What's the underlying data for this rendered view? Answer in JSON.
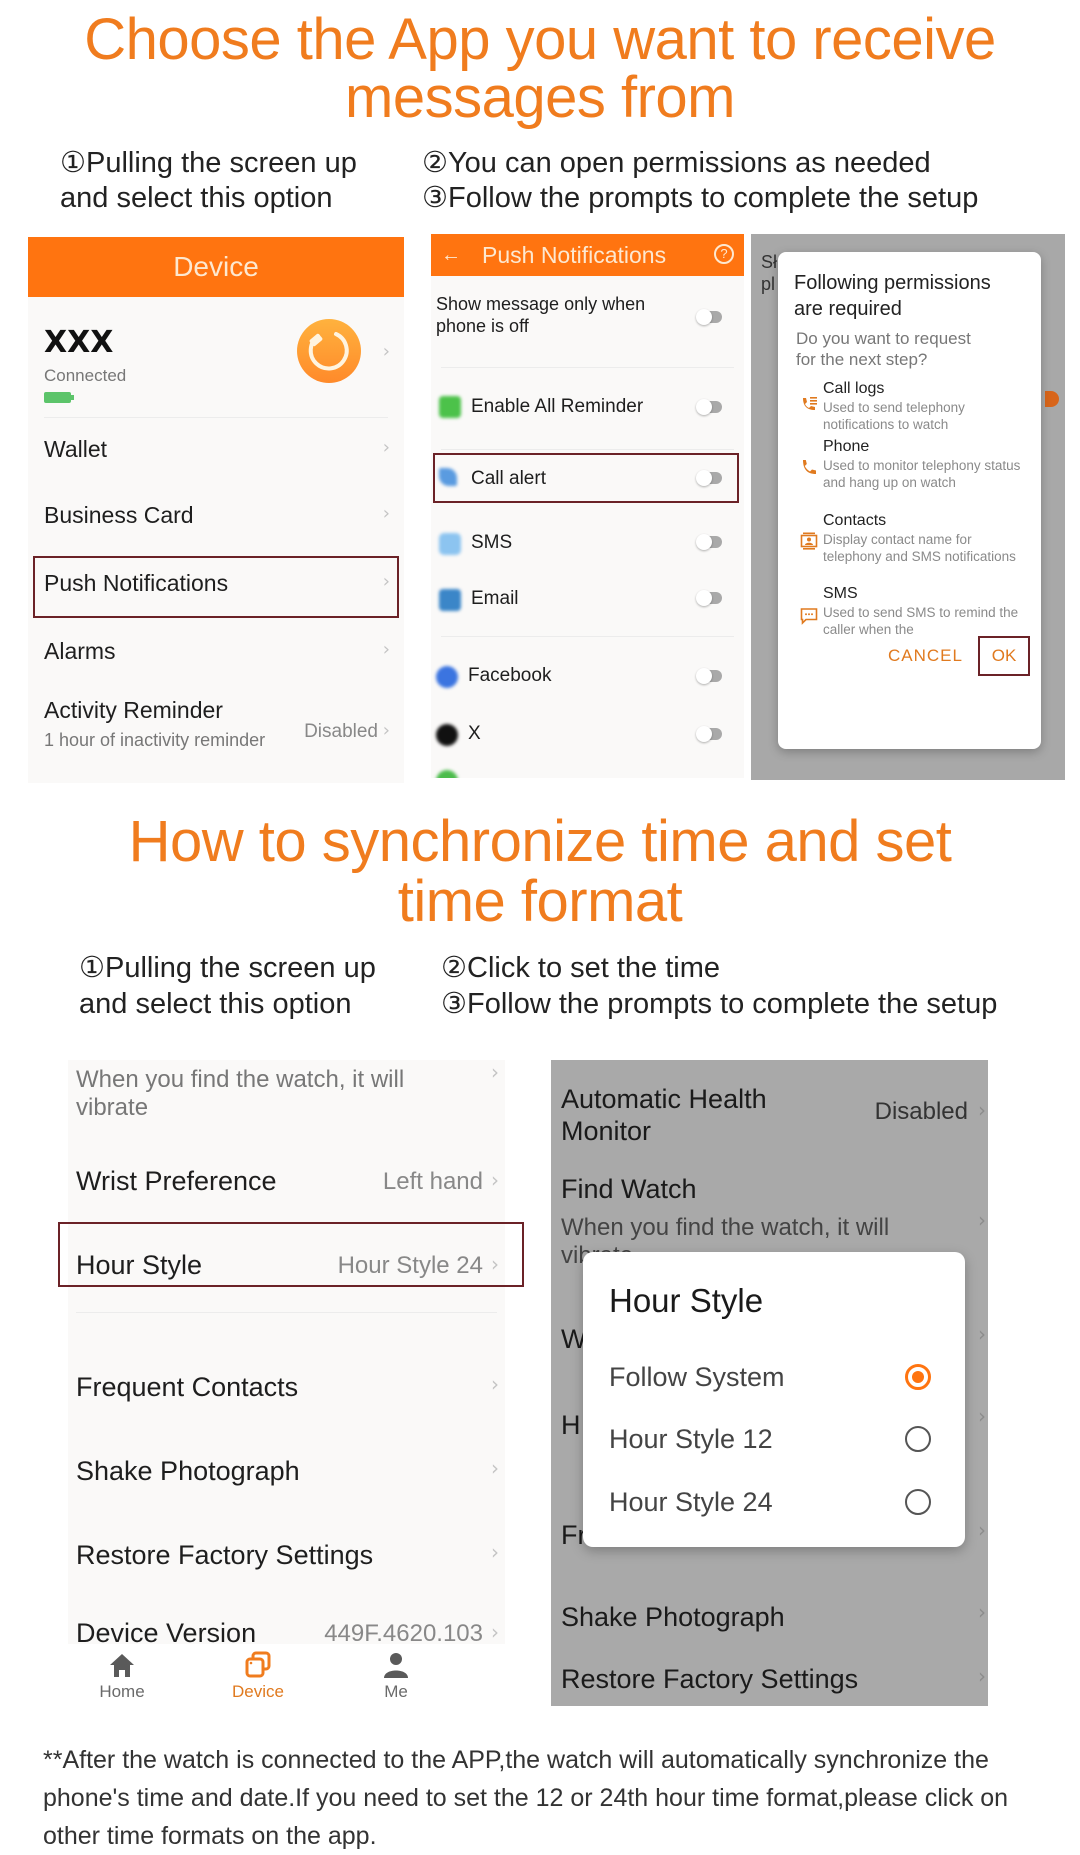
{
  "section1": {
    "title_line1": "Choose the App you want to receive",
    "title_line2": "messages from",
    "steps": [
      {
        "num": "①",
        "line1": "Pulling the screen up",
        "line2": "and select this option"
      },
      {
        "num": "②",
        "line1": "You can open permissions as needed"
      },
      {
        "num": "③",
        "line1": "Follow the prompts to complete the setup"
      }
    ]
  },
  "device_screen": {
    "title": "Device",
    "device_name": "XXX",
    "status": "Connected",
    "battery_color": "#5cc46a",
    "items": [
      {
        "label": "Wallet"
      },
      {
        "label": "Business Card"
      },
      {
        "label": "Push Notifications",
        "highlighted": true
      },
      {
        "label": "Alarms"
      },
      {
        "label": "Activity Reminder",
        "sub": "1 hour of inactivity reminder",
        "value": "Disabled"
      }
    ]
  },
  "push_screen": {
    "title": "Push Notifications",
    "items": [
      {
        "label": "Show message only when",
        "label2": "phone is off",
        "on": false
      },
      {
        "label": "Enable All Reminder",
        "icon": "reminder-icon",
        "on": false
      },
      {
        "label": "Call alert",
        "icon": "phone-icon",
        "on": false,
        "highlighted": true
      },
      {
        "label": "SMS",
        "icon": "sms-icon",
        "on": false
      },
      {
        "label": "Email",
        "icon": "email-icon",
        "on": false
      },
      {
        "label": "Facebook",
        "icon": "facebook-icon",
        "on": false
      },
      {
        "label": "X",
        "icon": "x-icon",
        "on": false
      }
    ]
  },
  "permission_dialog": {
    "bg_fragment1": "Sł",
    "bg_fragment2": "pl",
    "title_line1": "Following permissions",
    "title_line2": "are required",
    "question_line1": "Do you want to request",
    "question_line2": "for the next step?",
    "permissions": [
      {
        "title": "Call logs",
        "desc": "Used to send telephony notifications to watch",
        "icon": "call-log-icon"
      },
      {
        "title": "Phone",
        "desc": "Used to monitor telephony status and hang up on watch",
        "icon": "phone-icon"
      },
      {
        "title": "Contacts",
        "desc": "Display contact name for telephony and SMS notifications",
        "icon": "contacts-icon"
      },
      {
        "title": "SMS",
        "desc": "Used to send SMS to remind the caller when the",
        "icon": "message-icon"
      }
    ],
    "cancel_label": "CANCEL",
    "ok_label": "OK",
    "accent": "#e07a1f"
  },
  "section2": {
    "title_line1": "How to synchronize time and set",
    "title_line2": "time format",
    "steps": [
      {
        "num": "①",
        "line1": "Pulling the screen up",
        "line2": "and select this option"
      },
      {
        "num": "②",
        "line1": "Click to set the time"
      },
      {
        "num": "③",
        "line1": "Follow the prompts to complete the setup"
      }
    ]
  },
  "settings_screen": {
    "find_watch_desc_line1": "When you find the watch, it will",
    "find_watch_desc_line2": "vibrate",
    "items": [
      {
        "label": "Wrist Preference",
        "value": "Left hand"
      },
      {
        "label": "Hour Style",
        "value": "Hour Style 24",
        "highlighted": true
      },
      {
        "label": "Frequent Contacts"
      },
      {
        "label": "Shake Photograph"
      },
      {
        "label": "Restore Factory Settings"
      },
      {
        "label": "Device Version",
        "value": "449F.4620.103"
      }
    ],
    "nav": [
      {
        "label": "Home",
        "icon": "home-icon",
        "active": false
      },
      {
        "label": "Device",
        "icon": "device-icon",
        "active": true
      },
      {
        "label": "Me",
        "icon": "person-icon",
        "active": false
      }
    ]
  },
  "hour_dialog_screen": {
    "bg_items": {
      "health_line1": "Automatic Health",
      "health_line2": "Monitor",
      "health_value": "Disabled",
      "find_watch": "Find Watch",
      "find_desc_line1": "When you find the watch, it will",
      "find_desc_line2": "vibrate",
      "frag_w": "W",
      "frag_h": "H",
      "frag_fr": "Fr",
      "shake": "Shake Photograph",
      "restore": "Restore Factory Settings"
    },
    "dialog_title": "Hour Style",
    "options": [
      {
        "label": "Follow System",
        "selected": true
      },
      {
        "label": "Hour Style 12",
        "selected": false
      },
      {
        "label": "Hour Style 24",
        "selected": false
      }
    ]
  },
  "footer": {
    "line1": "**After the watch is connected to the APP,the watch will automatically synchronize the",
    "line2": "phone's time and date.If you need to set the 12 or 24th hour time format,please click on",
    "line3": "other time formats on the app."
  }
}
